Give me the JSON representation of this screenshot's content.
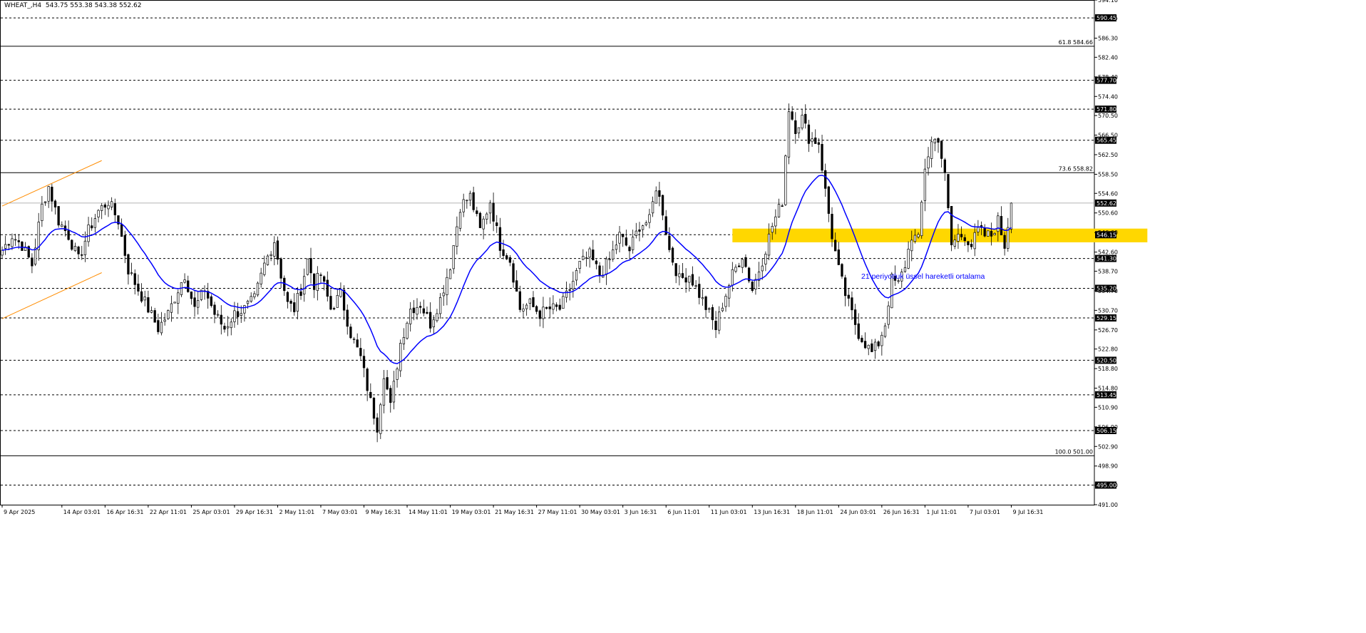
{
  "header": {
    "symbol": "WHEAT_,H4",
    "ohlc": "543.75 553.38 543.38 552.62"
  },
  "chart_data": {
    "type": "candlestick",
    "symbol": "WHEAT_",
    "timeframe": "H4",
    "ylim": [
      491.0,
      594.1
    ],
    "price_ticks": [
      "594.10",
      "590.45",
      "586.30",
      "582.40",
      "578.40",
      "574.40",
      "570.50",
      "566.50",
      "562.50",
      "558.50",
      "554.60",
      "550.60",
      "546.60",
      "542.60",
      "538.70",
      "534.70",
      "530.70",
      "526.70",
      "522.80",
      "518.80",
      "514.80",
      "510.90",
      "506.90",
      "502.90",
      "498.90",
      "495.00",
      "491.00"
    ],
    "horizontal_levels": [
      {
        "price": 590.45,
        "style": "dashed",
        "marker": "590.45"
      },
      {
        "price": 577.7,
        "style": "dashed",
        "marker": "577.70"
      },
      {
        "price": 571.8,
        "style": "dashed",
        "marker": "571.80"
      },
      {
        "price": 565.45,
        "style": "dashed",
        "marker": "565.45"
      },
      {
        "price": 546.15,
        "style": "dashed",
        "marker": "546.15"
      },
      {
        "price": 541.3,
        "style": "dashed",
        "marker": "541.30"
      },
      {
        "price": 535.2,
        "style": "dashed",
        "marker": "535.20"
      },
      {
        "price": 529.15,
        "style": "dashed",
        "marker": "529.15"
      },
      {
        "price": 520.5,
        "style": "dashed",
        "marker": "520.50"
      },
      {
        "price": 513.45,
        "style": "dashed",
        "marker": "513.45"
      },
      {
        "price": 506.15,
        "style": "dashed",
        "marker": "506.15"
      },
      {
        "price": 495.0,
        "style": "dashed",
        "marker": "495.00"
      }
    ],
    "fib_levels": [
      {
        "price": 584.66,
        "label": "61.8 584.66"
      },
      {
        "price": 558.82,
        "label": "73.6 558.82"
      },
      {
        "price": 501.0,
        "label": "100.0 501.00"
      }
    ],
    "current_price": 552.62,
    "zone": {
      "from": 544.6,
      "to": 547.4,
      "start_bar": 220,
      "end_bar": 345,
      "color": "#FFD700"
    },
    "annotation": "21 periyotluk üssel hareketli ortalama",
    "ema_period": 21,
    "x_labels": [
      {
        "bar": 0,
        "text": "9 Apr 2025"
      },
      {
        "bar": 18,
        "text": "14 Apr 03:01"
      },
      {
        "bar": 31,
        "text": "16 Apr 16:31"
      },
      {
        "bar": 44,
        "text": "22 Apr 11:01"
      },
      {
        "bar": 57,
        "text": "25 Apr 03:01"
      },
      {
        "bar": 70,
        "text": "29 Apr 16:31"
      },
      {
        "bar": 83,
        "text": "2 May 11:01"
      },
      {
        "bar": 96,
        "text": "7 May 03:01"
      },
      {
        "bar": 109,
        "text": "9 May 16:31"
      },
      {
        "bar": 122,
        "text": "14 May 11:01"
      },
      {
        "bar": 135,
        "text": "19 May 03:01"
      },
      {
        "bar": 148,
        "text": "21 May 16:31"
      },
      {
        "bar": 161,
        "text": "27 May 11:01"
      },
      {
        "bar": 174,
        "text": "30 May 03:01"
      },
      {
        "bar": 187,
        "text": "3 Jun 16:31"
      },
      {
        "bar": 200,
        "text": "6 Jun 11:01"
      },
      {
        "bar": 213,
        "text": "11 Jun 03:01"
      },
      {
        "bar": 226,
        "text": "13 Jun 16:31"
      },
      {
        "bar": 239,
        "text": "18 Jun 11:01"
      },
      {
        "bar": 252,
        "text": "24 Jun 03:01"
      },
      {
        "bar": 265,
        "text": "26 Jun 16:31"
      },
      {
        "bar": 278,
        "text": "1 Jul 11:01"
      },
      {
        "bar": 291,
        "text": "7 Jul 03:01"
      },
      {
        "bar": 304,
        "text": "9 Jul 16:31"
      }
    ],
    "price_anchors": [
      [
        0,
        543
      ],
      [
        3,
        546
      ],
      [
        6,
        544
      ],
      [
        9,
        540
      ],
      [
        12,
        552
      ],
      [
        14,
        556
      ],
      [
        17,
        549
      ],
      [
        20,
        546
      ],
      [
        23,
        541
      ],
      [
        26,
        547
      ],
      [
        29,
        551
      ],
      [
        32,
        553
      ],
      [
        35,
        549
      ],
      [
        38,
        539
      ],
      [
        41,
        535
      ],
      [
        44,
        531
      ],
      [
        47,
        527
      ],
      [
        50,
        530
      ],
      [
        53,
        535
      ],
      [
        55,
        538
      ],
      [
        58,
        531
      ],
      [
        61,
        535
      ],
      [
        64,
        530
      ],
      [
        67,
        527
      ],
      [
        70,
        530
      ],
      [
        73,
        531
      ],
      [
        76,
        533
      ],
      [
        79,
        540
      ],
      [
        82,
        545
      ],
      [
        84,
        538
      ],
      [
        86,
        532
      ],
      [
        88,
        531
      ],
      [
        90,
        535
      ],
      [
        92,
        541
      ],
      [
        94,
        536
      ],
      [
        96,
        538
      ],
      [
        99,
        531
      ],
      [
        102,
        534
      ],
      [
        105,
        526
      ],
      [
        108,
        521
      ],
      [
        111,
        512
      ],
      [
        113,
        507
      ],
      [
        115,
        518
      ],
      [
        117,
        511
      ],
      [
        120,
        524
      ],
      [
        123,
        531
      ],
      [
        126,
        532
      ],
      [
        129,
        528
      ],
      [
        132,
        533
      ],
      [
        135,
        540
      ],
      [
        138,
        552
      ],
      [
        141,
        554
      ],
      [
        144,
        547
      ],
      [
        147,
        553
      ],
      [
        150,
        544
      ],
      [
        153,
        541
      ],
      [
        156,
        531
      ],
      [
        159,
        532
      ],
      [
        162,
        530
      ],
      [
        165,
        531
      ],
      [
        168,
        531
      ],
      [
        171,
        535
      ],
      [
        174,
        540
      ],
      [
        177,
        542
      ],
      [
        180,
        538
      ],
      [
        183,
        541
      ],
      [
        186,
        546
      ],
      [
        189,
        543
      ],
      [
        192,
        548
      ],
      [
        195,
        549
      ],
      [
        197,
        556
      ],
      [
        199,
        551
      ],
      [
        201,
        543
      ],
      [
        204,
        537
      ],
      [
        207,
        538
      ],
      [
        210,
        534
      ],
      [
        213,
        530
      ],
      [
        215,
        527
      ],
      [
        217,
        532
      ],
      [
        220,
        538
      ],
      [
        223,
        542
      ],
      [
        226,
        535
      ],
      [
        229,
        541
      ],
      [
        232,
        548
      ],
      [
        235,
        553
      ],
      [
        237,
        572
      ],
      [
        239,
        568
      ],
      [
        241,
        570
      ],
      [
        243,
        566
      ],
      [
        246,
        565
      ],
      [
        248,
        555
      ],
      [
        250,
        546
      ],
      [
        252,
        539
      ],
      [
        254,
        534
      ],
      [
        256,
        530
      ],
      [
        258,
        526
      ],
      [
        260,
        524
      ],
      [
        262,
        522
      ],
      [
        264,
        524
      ],
      [
        266,
        528
      ],
      [
        268,
        537
      ],
      [
        270,
        536
      ],
      [
        272,
        540
      ],
      [
        274,
        546
      ],
      [
        276,
        545
      ],
      [
        278,
        560
      ],
      [
        280,
        565
      ],
      [
        282,
        566
      ],
      [
        284,
        558
      ],
      [
        286,
        544
      ],
      [
        288,
        546
      ],
      [
        290,
        546
      ],
      [
        292,
        544
      ],
      [
        294,
        547
      ],
      [
        296,
        546
      ],
      [
        298,
        546
      ],
      [
        300,
        549
      ],
      [
        302,
        544
      ],
      [
        304,
        552.6
      ]
    ],
    "x_domain": [
      0,
      314
    ]
  },
  "colors": {
    "background": "#ffffff",
    "grid_dash": "#000000",
    "candle": "#000000",
    "ema": "#0000FF",
    "channel": "#FF8C00",
    "zone": "#FFD700",
    "annotation": "#0000FF",
    "marker_bg": "#000000",
    "marker_text": "#ffffff"
  }
}
